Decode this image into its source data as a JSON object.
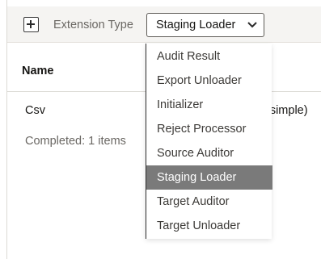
{
  "toolbar": {
    "add_icon": "plus-square-icon",
    "extension_type_label": "Extension Type",
    "select_value": "Staging Loader",
    "chevron_icon": "chevron-down-icon"
  },
  "table": {
    "columns": [
      "Name",
      ""
    ],
    "rows": [
      {
        "name": "Csv",
        "type": "(simple)"
      }
    ],
    "status": "Completed: 1 items"
  },
  "dropdown": {
    "options": [
      "Audit Result",
      "Export Unloader",
      "Initializer",
      "Reject Processor",
      "Source Auditor",
      "Staging Loader",
      "Target Auditor",
      "Target Unloader"
    ],
    "selected": "Staging Loader"
  },
  "colors": {
    "toolbar_bg": "#f5f4f2",
    "selected_option_bg": "#7a7a7a",
    "text": "#161513",
    "muted_text": "#6a6763"
  }
}
